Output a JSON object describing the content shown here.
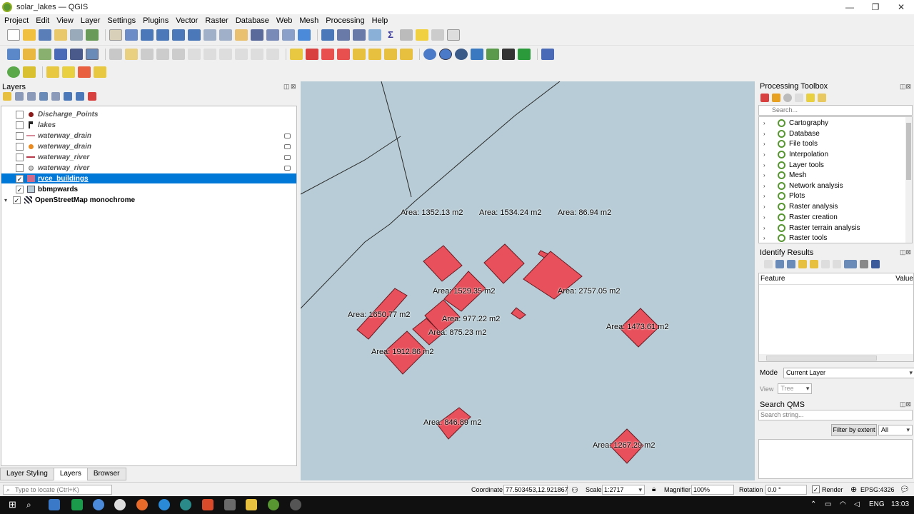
{
  "window": {
    "title": "solar_lakes — QGIS",
    "controls": {
      "minimize": "—",
      "maximize": "❐",
      "close": "✕"
    }
  },
  "menu": [
    "Project",
    "Edit",
    "View",
    "Layer",
    "Settings",
    "Plugins",
    "Vector",
    "Raster",
    "Database",
    "Web",
    "Mesh",
    "Processing",
    "Help"
  ],
  "layers_panel": {
    "title": "Layers",
    "layers": [
      {
        "name": "Discharge_Points",
        "checked": false,
        "symbol": "point-dark-red"
      },
      {
        "name": "lakes",
        "checked": false,
        "symbol": "flag"
      },
      {
        "name": "waterway_drain",
        "checked": false,
        "symbol": "line-pink",
        "flag": true
      },
      {
        "name": "waterway_drain",
        "checked": false,
        "symbol": "point-orange",
        "flag": true
      },
      {
        "name": "waterway_river",
        "checked": false,
        "symbol": "line-red",
        "flag": true
      },
      {
        "name": "waterway_river",
        "checked": false,
        "symbol": "point-grey",
        "flag": true
      },
      {
        "name": "rvce_buildings",
        "checked": true,
        "symbol": "fill-pink",
        "selected": true
      },
      {
        "name": "bbmpwards",
        "checked": true,
        "symbol": "fill-grey"
      },
      {
        "name": "OpenStreetMap monochrome",
        "checked": true,
        "symbol": "tile",
        "expander": "▾"
      }
    ],
    "check_mark": "✓"
  },
  "bottom_tabs": [
    "Layer Styling",
    "Layers",
    "Browser"
  ],
  "map": {
    "background": "#b7ccd6",
    "fill": "#e8505b",
    "labels": [
      "Area: 1352.13 m2",
      "Area: 1534.24 m2",
      "Area: 86.94 m2",
      "Area: 1529.35 m2",
      "Area: 2757.05 m2",
      "Area: 1650.77 m2",
      "Area: 977.22 m2",
      "Area: 875.23 m2",
      "Area: 1473.61 m2",
      "Area: 1912.86 m2",
      "Area: 846.89 m2",
      "Area: 1267.29 m2"
    ]
  },
  "processing": {
    "title": "Processing Toolbox",
    "search_placeholder": "Search...",
    "items": [
      "Cartography",
      "Database",
      "File tools",
      "Interpolation",
      "Layer tools",
      "Mesh",
      "Network analysis",
      "Plots",
      "Raster analysis",
      "Raster creation",
      "Raster terrain analysis",
      "Raster tools"
    ]
  },
  "identify": {
    "title": "Identify Results",
    "col_feature": "Feature",
    "col_value": "Value",
    "mode_label": "Mode",
    "mode_value": "Current Layer",
    "view_label": "View",
    "view_value": "Tree"
  },
  "qms": {
    "title": "Search QMS",
    "placeholder": "Search string...",
    "filter_button": "Filter by extent",
    "filter_value": "All"
  },
  "status": {
    "locate_placeholder": "Type to locate (Ctrl+K)",
    "coordinate_label": "Coordinate",
    "coordinate_value": "77.503453,12.921867",
    "scale_label": "Scale",
    "scale_value": "1:2717",
    "magnifier_label": "Magnifier",
    "magnifier_value": "100%",
    "rotation_label": "Rotation",
    "rotation_value": "0.0 °",
    "render_label": "Render",
    "crs": "EPSG:4326"
  },
  "taskbar": {
    "lang": "ENG",
    "time": "13:03"
  }
}
